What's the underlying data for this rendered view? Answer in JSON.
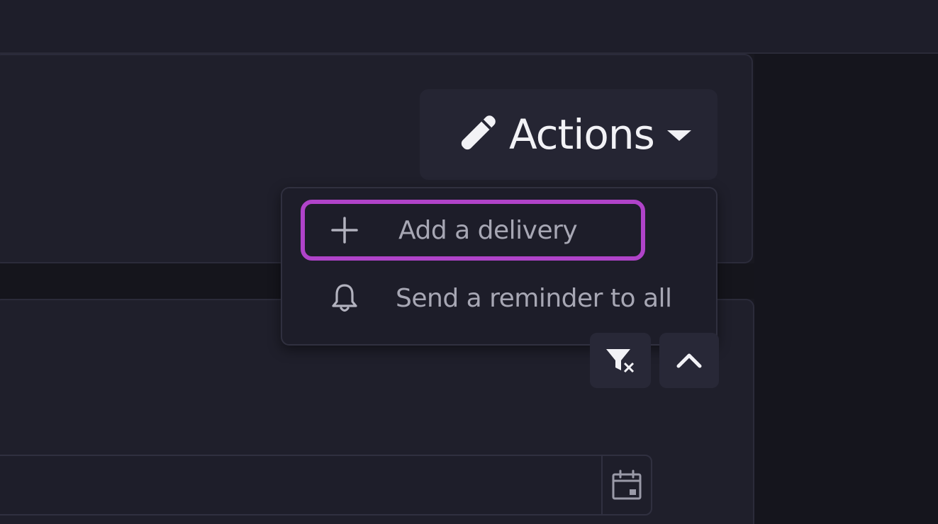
{
  "actions": {
    "label": "Actions",
    "icon": "pencil-icon"
  },
  "menu": {
    "items": [
      {
        "label": "Add a delivery",
        "icon": "plus-icon",
        "highlighted": true
      },
      {
        "label": "Send a reminder to all",
        "icon": "bell-icon",
        "highlighted": false
      }
    ]
  },
  "toolbar": {
    "filter_icon": "clear-filter-icon",
    "collapse_icon": "chevron-up-icon"
  },
  "date_field": {
    "value": "",
    "icon": "calendar-icon"
  },
  "colors": {
    "highlight": "#b043c9",
    "text": "#f2f2f6",
    "muted_text": "#a7a7b4",
    "background": "#1f1f2b"
  }
}
